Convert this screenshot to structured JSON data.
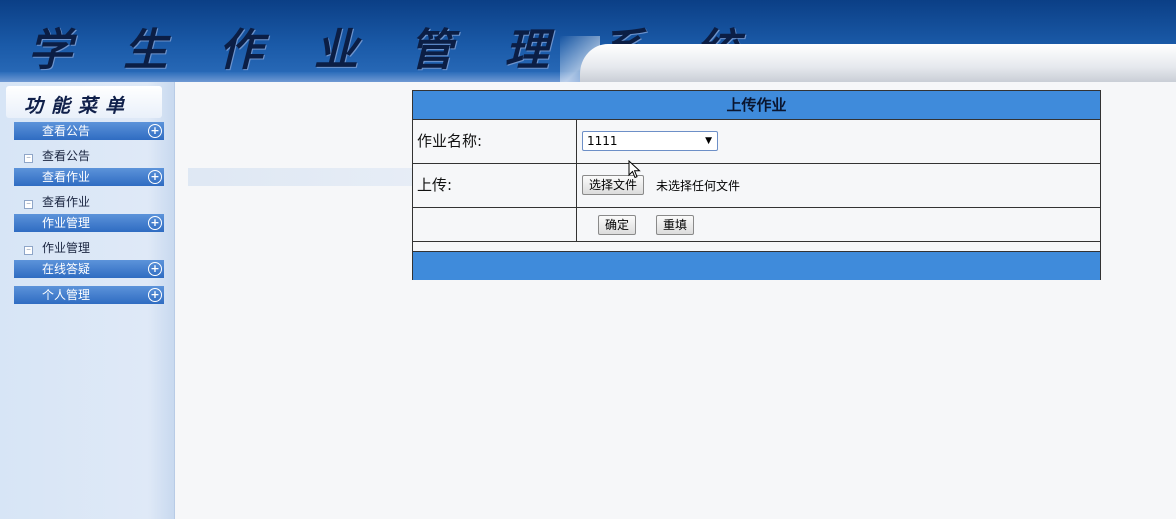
{
  "header": {
    "title": "学 生 作 业 管 理 系 统"
  },
  "sidebar": {
    "menu_title": "功能菜单",
    "groups": [
      {
        "label": "查看公告",
        "sub": "查看公告"
      },
      {
        "label": "查看作业",
        "sub": "查看作业"
      },
      {
        "label": "作业管理",
        "sub": "作业管理"
      },
      {
        "label": "在线答疑"
      },
      {
        "label": "个人管理"
      }
    ],
    "expand_glyph": "+"
  },
  "form": {
    "caption": "上传作业",
    "homework_name_label": "作业名称:",
    "homework_selected": "1111",
    "upload_label": "上传:",
    "choose_file_button": "选择文件",
    "file_status": "未选择任何文件",
    "confirm_button": "确定",
    "reset_button": "重填"
  },
  "colors": {
    "accent": "#3f8bdb",
    "header_dark": "#0b3f86",
    "menu_head": "#2f6cc2"
  }
}
